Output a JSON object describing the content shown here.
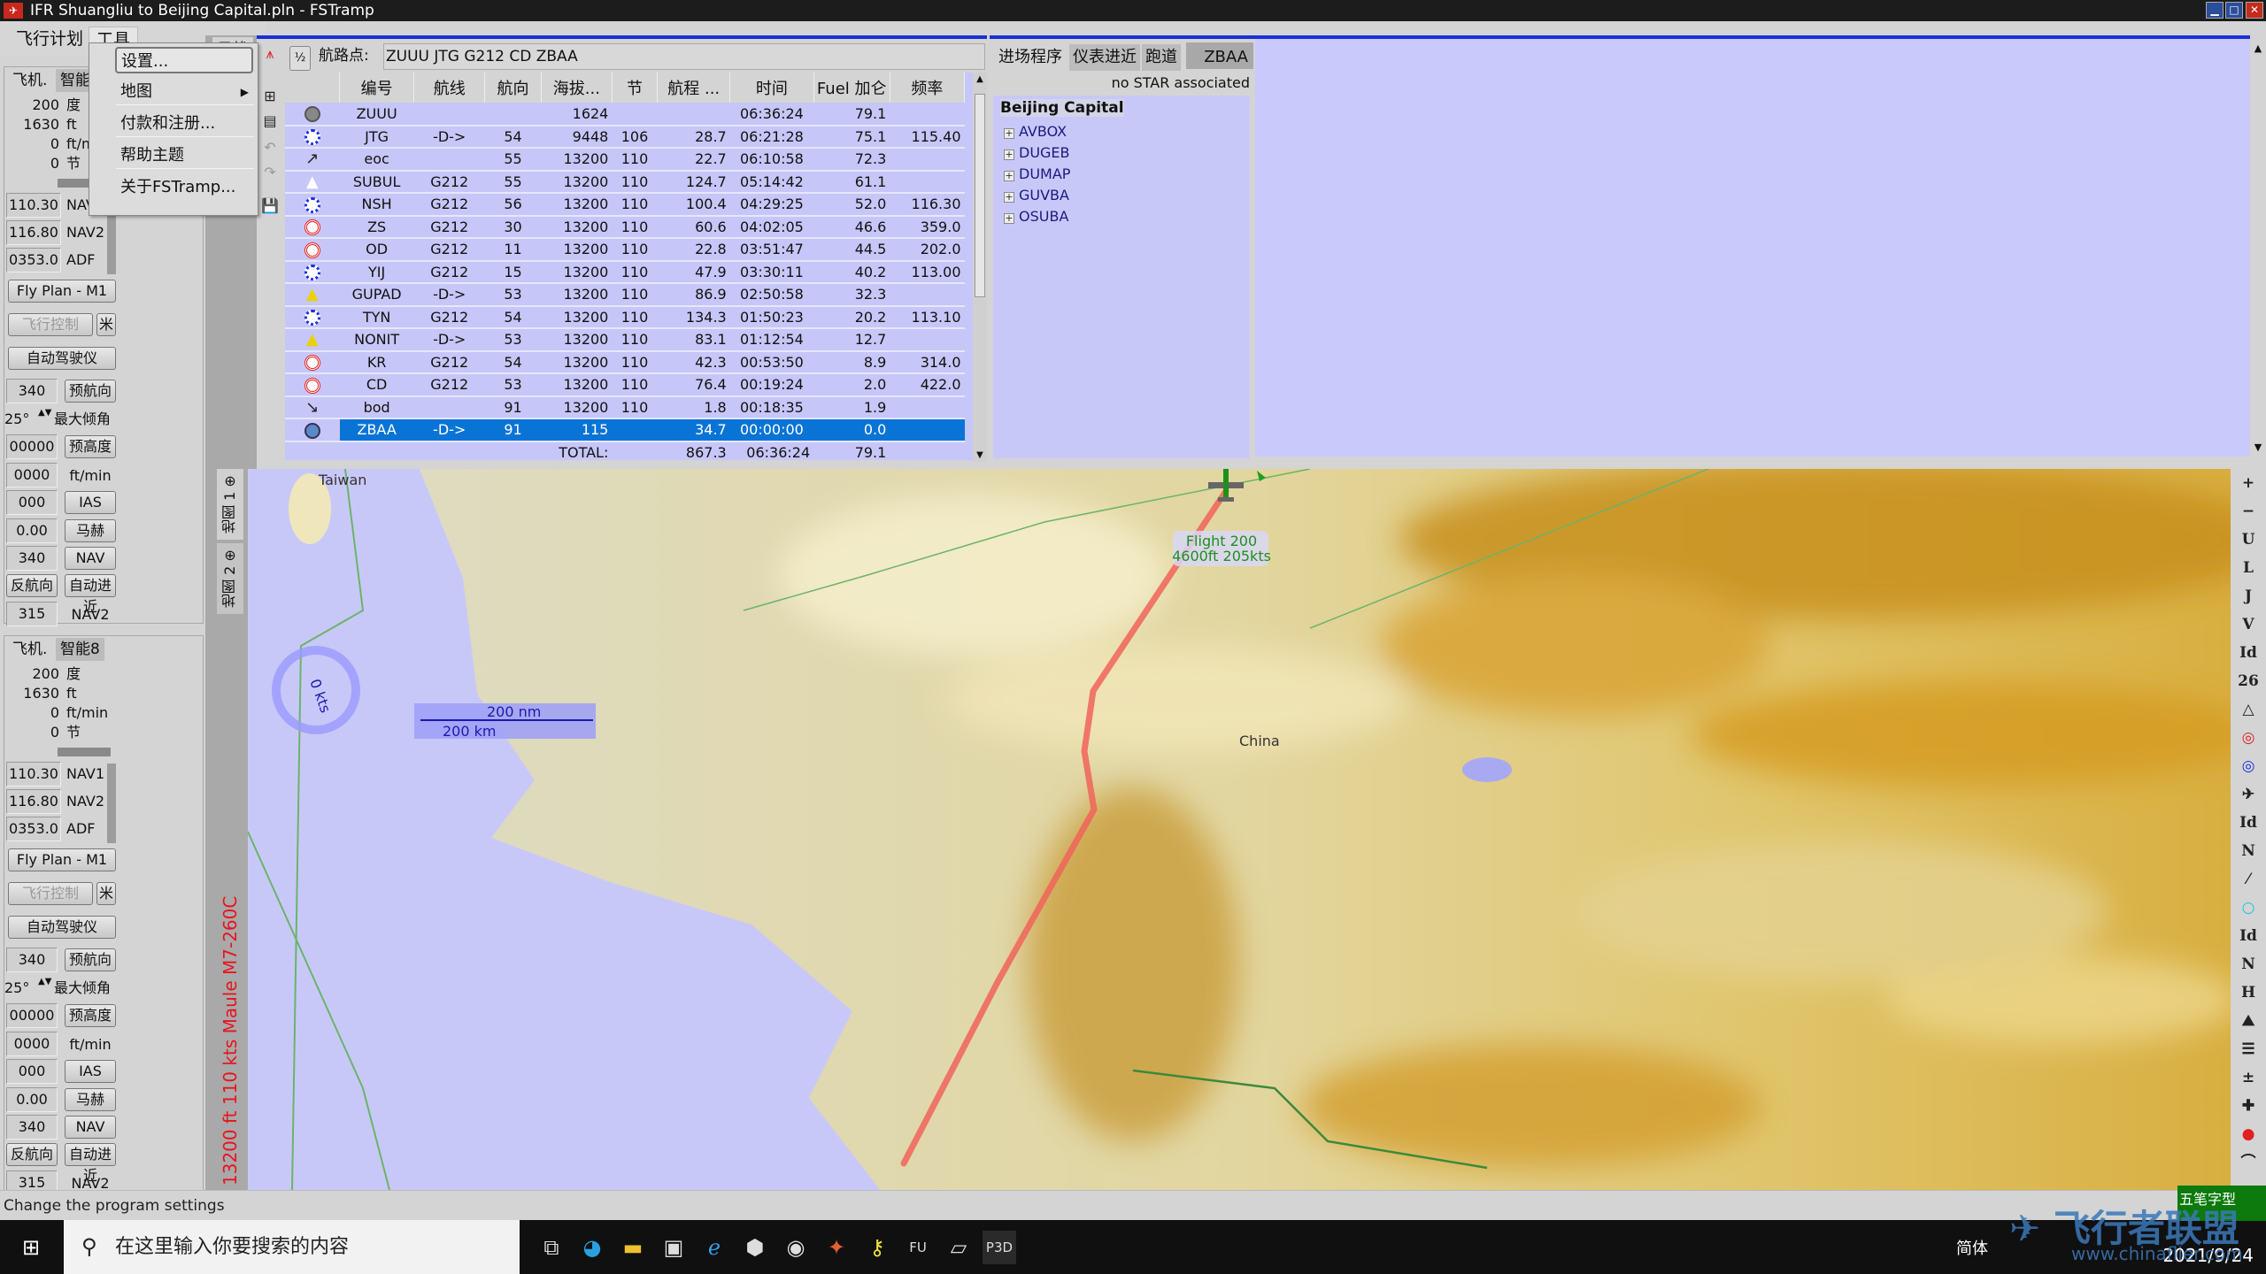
{
  "window": {
    "title": "IFR Shuangliu to Beijing Capital.pln - FSTramp"
  },
  "menu": {
    "flight_plan": "飞行计划",
    "tools": "工具"
  },
  "dropdown": {
    "items": [
      {
        "label": "设置..."
      },
      {
        "label": "地图"
      },
      {
        "label": "付款和注册..."
      },
      {
        "label": "帮助主题"
      },
      {
        "label": "关于FSTramp..."
      }
    ]
  },
  "panels": [
    {
      "tab1": "飞机.",
      "tab2": "智能",
      "heading": "200",
      "heading_unit": "度",
      "alt": "1630",
      "alt_unit": "ft",
      "vs": "0",
      "vs_unit": "ft/min",
      "speed": "0",
      "speed_unit": "节",
      "nav1": "110.30",
      "nav1_label": "NAV1",
      "nav2": "116.80",
      "nav2_label": "NAV2",
      "adf": "0353.0",
      "adf_label": "ADF",
      "fly_plan": "Fly Plan - M1",
      "flight_control": "飞行控制",
      "star_btn": "米",
      "autopilot": "自动驾驶仪",
      "hdg_val": "340",
      "hdg_btn": "预航向",
      "bank_val": "25°",
      "bank_label": "最大倾角",
      "alt_val": "00000",
      "alt_btn": "预高度",
      "vs_val": "0000",
      "vs_label": "ft/min",
      "ias_val": "000",
      "ias_btn": "IAS",
      "mach_val": "0.00",
      "mach_btn": "马赫",
      "nav_val": "340",
      "nav_btn": "NAV",
      "rev_btn": "反航向",
      "approach_btn": "自动进近",
      "nav2_val": "315",
      "nav2_btn": "NAV2"
    },
    {
      "tab1": "飞机.",
      "tab2": "智能8",
      "heading": "200",
      "heading_unit": "度",
      "alt": "1630",
      "alt_unit": "ft",
      "vs": "0",
      "vs_unit": "ft/min",
      "speed": "0",
      "speed_unit": "节",
      "nav1": "110.30",
      "nav1_label": "NAV1",
      "nav2": "116.80",
      "nav2_label": "NAV2",
      "adf": "0353.0",
      "adf_label": "ADF",
      "fly_plan": "Fly Plan - M1",
      "flight_control": "飞行控制",
      "star_btn": "米",
      "autopilot": "自动驾驶仪",
      "hdg_val": "340",
      "hdg_btn": "预航向",
      "bank_val": "25°",
      "bank_label": "最大倾角",
      "alt_val": "00000",
      "alt_btn": "预高度",
      "vs_val": "0000",
      "vs_label": "ft/min",
      "ias_val": "000",
      "ias_btn": "IAS",
      "mach_val": "0.00",
      "mach_btn": "马赫",
      "nav_val": "340",
      "nav_btn": "NAV",
      "rev_btn": "反航向",
      "approach_btn": "自动进近",
      "nav2_val": "315",
      "nav2_btn": "NAV2"
    }
  ],
  "find_tab": "寻找",
  "map_tabs": [
    "地图 1",
    "地图 2"
  ],
  "aircraft_info": "13200 ft   110 kts   Maule M7-260C",
  "flightplan": {
    "half_label": "½",
    "route_label": "航路点:",
    "route": "ZUUU JTG G212 CD ZBAA",
    "columns": [
      "编号",
      "航线",
      "航向",
      "海拔...",
      "节",
      "航程 ...",
      "时间",
      "Fuel 加仑",
      "频率"
    ],
    "rows": [
      {
        "icon": "airport",
        "id": "ZUUU",
        "airway": "",
        "hdg": "",
        "alt": "1624",
        "kts": "",
        "dist": "",
        "time": "06:36:24",
        "fuel": "79.1",
        "freq": ""
      },
      {
        "icon": "vor",
        "id": "JTG",
        "airway": "-D->",
        "hdg": "54",
        "alt": "9448",
        "kts": "106",
        "dist": "28.7",
        "time": "06:21:28",
        "fuel": "75.1",
        "freq": "115.40"
      },
      {
        "icon": "toc",
        "id": "eoc",
        "airway": "",
        "hdg": "55",
        "alt": "13200",
        "kts": "110",
        "dist": "22.7",
        "time": "06:10:58",
        "fuel": "72.3",
        "freq": ""
      },
      {
        "icon": "fix-white",
        "id": "SUBUL",
        "airway": "G212",
        "hdg": "55",
        "alt": "13200",
        "kts": "110",
        "dist": "124.7",
        "time": "05:14:42",
        "fuel": "61.1",
        "freq": ""
      },
      {
        "icon": "vor",
        "id": "NSH",
        "airway": "G212",
        "hdg": "56",
        "alt": "13200",
        "kts": "110",
        "dist": "100.4",
        "time": "04:29:25",
        "fuel": "52.0",
        "freq": "116.30"
      },
      {
        "icon": "ndb",
        "id": "ZS",
        "airway": "G212",
        "hdg": "30",
        "alt": "13200",
        "kts": "110",
        "dist": "60.6",
        "time": "04:02:05",
        "fuel": "46.6",
        "freq": "359.0"
      },
      {
        "icon": "ndb",
        "id": "OD",
        "airway": "G212",
        "hdg": "11",
        "alt": "13200",
        "kts": "110",
        "dist": "22.8",
        "time": "03:51:47",
        "fuel": "44.5",
        "freq": "202.0"
      },
      {
        "icon": "vor",
        "id": "YIJ",
        "airway": "G212",
        "hdg": "15",
        "alt": "13200",
        "kts": "110",
        "dist": "47.9",
        "time": "03:30:11",
        "fuel": "40.2",
        "freq": "113.00"
      },
      {
        "icon": "fix-yellow",
        "id": "GUPAD",
        "airway": "-D->",
        "hdg": "53",
        "alt": "13200",
        "kts": "110",
        "dist": "86.9",
        "time": "02:50:58",
        "fuel": "32.3",
        "freq": ""
      },
      {
        "icon": "vor",
        "id": "TYN",
        "airway": "G212",
        "hdg": "54",
        "alt": "13200",
        "kts": "110",
        "dist": "134.3",
        "time": "01:50:23",
        "fuel": "20.2",
        "freq": "113.10"
      },
      {
        "icon": "fix-yellow",
        "id": "NONIT",
        "airway": "-D->",
        "hdg": "53",
        "alt": "13200",
        "kts": "110",
        "dist": "83.1",
        "time": "01:12:54",
        "fuel": "12.7",
        "freq": ""
      },
      {
        "icon": "ndb",
        "id": "KR",
        "airway": "G212",
        "hdg": "54",
        "alt": "13200",
        "kts": "110",
        "dist": "42.3",
        "time": "00:53:50",
        "fuel": "8.9",
        "freq": "314.0"
      },
      {
        "icon": "ndb",
        "id": "CD",
        "airway": "G212",
        "hdg": "53",
        "alt": "13200",
        "kts": "110",
        "dist": "76.4",
        "time": "00:19:24",
        "fuel": "2.0",
        "freq": "422.0"
      },
      {
        "icon": "tod",
        "id": "bod",
        "airway": "",
        "hdg": "91",
        "alt": "13200",
        "kts": "110",
        "dist": "1.8",
        "time": "00:18:35",
        "fuel": "1.9",
        "freq": ""
      },
      {
        "icon": "airport-selected",
        "id": "ZBAA",
        "airway": "-D->",
        "hdg": "91",
        "alt": "115",
        "kts": "",
        "dist": "34.7",
        "time": "00:00:00",
        "fuel": "0.0",
        "freq": "",
        "selected": true
      }
    ],
    "total": {
      "label": "TOTAL:",
      "dist": "867.3",
      "time": "06:36:24",
      "fuel": "79.1"
    }
  },
  "star": {
    "tabs": [
      "进场程序",
      "仪表进近",
      "跑道"
    ],
    "airport_code": "ZBAA",
    "message": "no STAR associated",
    "airport": "Beijing Capital",
    "items": [
      "AVBOX",
      "DUGEB",
      "DUMAP",
      "GUVBA",
      "OSUBA"
    ]
  },
  "map": {
    "labels": {
      "taiwan": "Taiwan",
      "china": "China"
    },
    "flight_tag": [
      "Flight 200",
      "4600ft 205kts"
    ],
    "compass": "0 kts",
    "scale_nm": "200 nm",
    "scale_km": "200 km",
    "route_color": "#f0645a",
    "sea_color": "#c8c8f8"
  },
  "map_tools": [
    "+",
    "−",
    "U",
    "L",
    "J",
    "V",
    "Id",
    "26",
    "△",
    "◎",
    "◎",
    "✈",
    "Id",
    "N",
    "⁄",
    "○",
    "Id",
    "N",
    "H",
    "⛰",
    "☰",
    "±",
    "✚",
    "●",
    "⌒"
  ],
  "status": "Change the program settings",
  "taskbar": {
    "search_placeholder": "在这里输入你要搜索的内容",
    "apps": [
      "task-view",
      "edge",
      "file-explorer",
      "store",
      "ie",
      "app-hex",
      "app-dial",
      "app-fire",
      "app-key",
      "app-fu",
      "app-glass",
      "P3D"
    ],
    "lang": "简体",
    "date": "2021/9/24",
    "ime": "五笔字型"
  },
  "watermark": {
    "name": "飞行者联盟",
    "url": "www.chinaflier.com"
  }
}
